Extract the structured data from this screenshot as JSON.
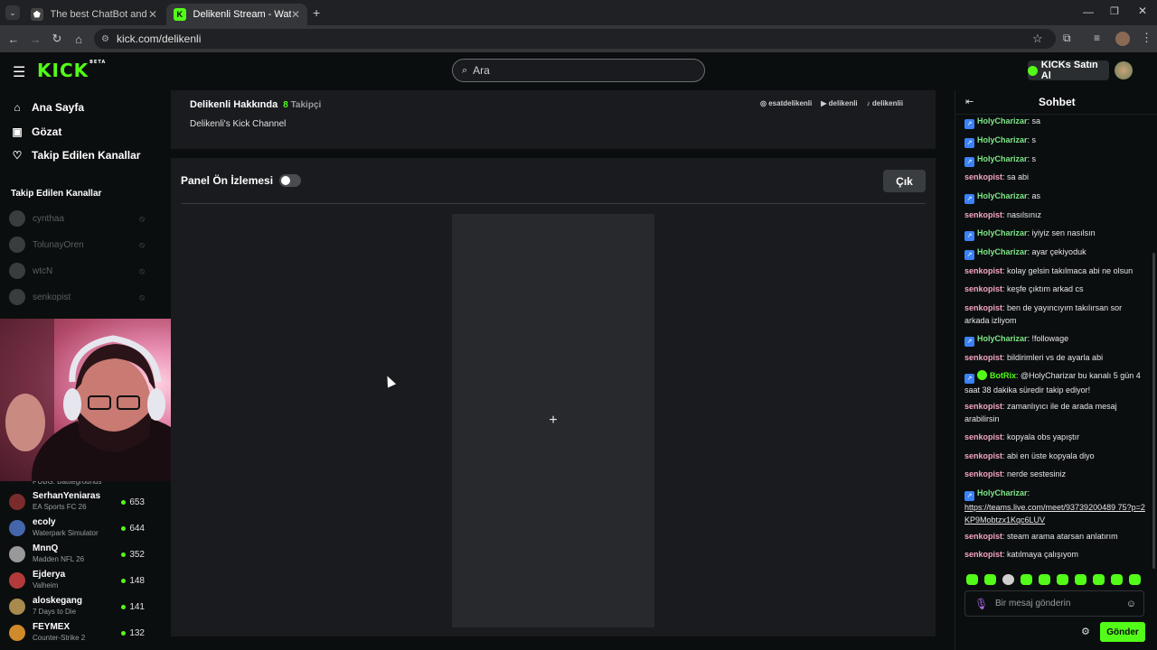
{
  "browser": {
    "tabs": [
      {
        "title": "The best ChatBot and Widgets",
        "active": false
      },
      {
        "title": "Delikenli Stream - Watch Live o",
        "active": true
      }
    ],
    "url": "kick.com/delikenli"
  },
  "header": {
    "logo": "KICK",
    "logo_beta": "BETA",
    "search_placeholder": "Ara",
    "kicks_button": "KICKs Satın Al"
  },
  "sidebar": {
    "nav": [
      {
        "label": "Ana Sayfa",
        "icon": "home-icon"
      },
      {
        "label": "Gözat",
        "icon": "browse-icon"
      },
      {
        "label": "Takip Edilen Kanallar",
        "icon": "heart-icon"
      }
    ],
    "followed_title": "Takip Edilen Kanallar",
    "offline_channels": [
      "cynthaa",
      "TolunayOren",
      "wtcN",
      "senkopist"
    ],
    "live_partial_game": "PUBG: Battlegrounds",
    "live_channels": [
      {
        "name": "SerhanYeniaras",
        "game": "EA Sports FC 26",
        "viewers": "653"
      },
      {
        "name": "ecoly",
        "game": "Waterpark Simulator",
        "viewers": "644"
      },
      {
        "name": "MnnQ",
        "game": "Madden NFL 26",
        "viewers": "352"
      },
      {
        "name": "Ejderya",
        "game": "Valheim",
        "viewers": "148"
      },
      {
        "name": "aloskegang",
        "game": "7 Days to Die",
        "viewers": "141"
      },
      {
        "name": "FEYMEX",
        "game": "Counter-Strike 2",
        "viewers": "132"
      }
    ]
  },
  "about": {
    "title": "Delikenli Hakkında",
    "followers_count": "8",
    "followers_label": "Takipçi",
    "description": "Delikenli's Kick Channel",
    "socials": [
      "esatdelikenli",
      "delikenli",
      "delikenlii"
    ]
  },
  "panel": {
    "title": "Panel Ön İzlemesi",
    "exit_button": "Çık",
    "add_symbol": "+"
  },
  "chat": {
    "title": "Sohbet",
    "messages": [
      {
        "user": "HolyCharizar",
        "text": "sa",
        "badge": true,
        "color": "#7ee787"
      },
      {
        "user": "HolyCharizar",
        "text": "s",
        "badge": true,
        "color": "#7ee787"
      },
      {
        "user": "HolyCharizar",
        "text": "s",
        "badge": true,
        "color": "#7ee787"
      },
      {
        "user": "senkopist",
        "text": "sa abi",
        "badge": false,
        "color": "#f4a5c0"
      },
      {
        "user": "HolyCharizar",
        "text": "as",
        "badge": true,
        "color": "#7ee787"
      },
      {
        "user": "senkopist",
        "text": "nasılsınız",
        "badge": false,
        "color": "#f4a5c0"
      },
      {
        "user": "HolyCharizar",
        "text": "iyiyiz sen nasılsın",
        "badge": true,
        "color": "#7ee787"
      },
      {
        "user": "HolyCharizar",
        "text": "ayar çekiyoduk",
        "badge": true,
        "color": "#7ee787"
      },
      {
        "user": "senkopist",
        "text": "kolay gelsin takılmaca abi ne olsun",
        "badge": false,
        "color": "#f4a5c0"
      },
      {
        "user": "senkopist",
        "text": "keşfe çıktım arkad cs",
        "badge": false,
        "color": "#f4a5c0"
      },
      {
        "user": "senkopist",
        "text": "ben de yayıncıyım takılırsan sor arkada izliyom",
        "badge": false,
        "color": "#f4a5c0"
      },
      {
        "user": "HolyCharizar",
        "text": "!followage",
        "badge": true,
        "color": "#7ee787"
      },
      {
        "user": "senkopist",
        "text": "bildirimleri vs de ayarla abi",
        "badge": false,
        "color": "#f4a5c0"
      },
      {
        "user": "BotRix",
        "text": "@HolyCharizar bu kanalı 5 gün 4 saat 38 dakika süredir takip ediyor!",
        "badge": true,
        "verified": true,
        "color": "#53fc18"
      },
      {
        "user": "senkopist",
        "text": "zamanlıyıcı ile de arada mesaj arabilirsin",
        "badge": false,
        "color": "#f4a5c0"
      },
      {
        "user": "senkopist",
        "text": "kopyala obs yapıştır",
        "badge": false,
        "color": "#f4a5c0"
      },
      {
        "user": "senkopist",
        "text": "abi en üste kopyala diyo",
        "badge": false,
        "color": "#f4a5c0"
      },
      {
        "user": "senkopist",
        "text": "nerde sestesiniz",
        "badge": false,
        "color": "#f4a5c0"
      },
      {
        "user": "HolyCharizar",
        "text": "https://teams.live.com/meet/93739200489 75?p=2KP9Mobtzx1Kqc6LUV",
        "badge": true,
        "color": "#7ee787",
        "link": true
      },
      {
        "user": "senkopist",
        "text": "steam arama atarsan anlatırım",
        "badge": false,
        "color": "#f4a5c0"
      },
      {
        "user": "senkopist",
        "text": "katılmaya çalışıyom",
        "badge": false,
        "color": "#f4a5c0"
      }
    ],
    "input_placeholder": "Bir mesaj gönderin",
    "send_button": "Gönder"
  },
  "colors": {
    "accent": "#53fc18",
    "panel_bg": "#191b1f",
    "page_bg": "#0b0e0f"
  }
}
